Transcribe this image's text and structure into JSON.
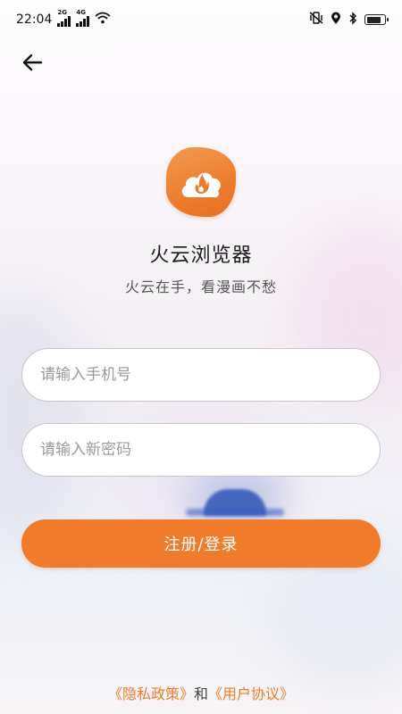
{
  "status_bar": {
    "time": "22:04",
    "sim1_label": "2G",
    "sim2_label": "4G",
    "icons": [
      "signal-icon",
      "signal-icon",
      "wifi-icon",
      "vibrate-icon",
      "location-icon",
      "bluetooth-icon",
      "battery-icon"
    ]
  },
  "nav": {
    "back_icon": "arrow-left-icon"
  },
  "app": {
    "logo_icon": "flame-cloud-icon",
    "name": "火云浏览器",
    "slogan": "火云在手，看漫画不愁"
  },
  "form": {
    "phone_placeholder": "请输入手机号",
    "phone_value": "",
    "password_placeholder": "请输入新密码",
    "password_value": "",
    "submit_label": "注册/登录"
  },
  "footer": {
    "privacy_link": "《隐私政策》",
    "connector": "和",
    "terms_link": "《用户协议》"
  },
  "colors": {
    "accent": "#EF7B2B",
    "link": "#EE7B2C",
    "text_primary": "#1B1B1B",
    "text_secondary": "#555555",
    "placeholder": "#9A9A9A"
  }
}
